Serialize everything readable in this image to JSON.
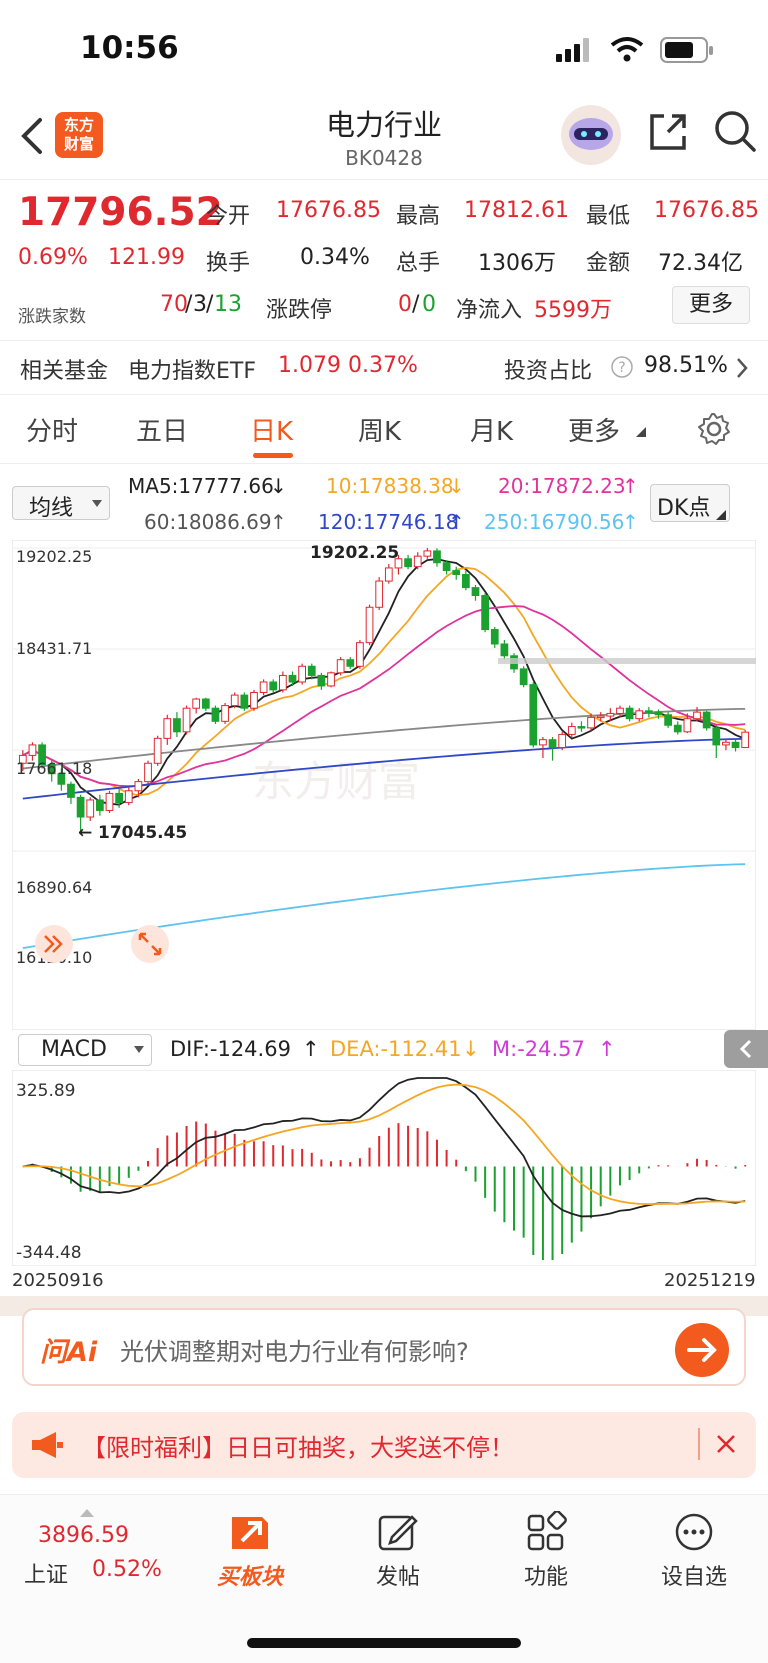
{
  "status_bar": {
    "time": "10:56"
  },
  "header": {
    "logo_text": "东方\n财富",
    "title": "电力行业",
    "code": "BK0428"
  },
  "quote": {
    "price": "17796.52",
    "change_pct": "0.69%",
    "change_abs": "121.99",
    "open_label": "今开",
    "open": "17676.85",
    "high_label": "最高",
    "high": "17812.61",
    "low_label": "最低",
    "low": "17676.85",
    "turnover_label": "换手",
    "turnover": "0.34%",
    "volume_label": "总手",
    "volume": "1306万",
    "amount_label": "金额",
    "amount": "72.34亿",
    "adv_dec_label": "涨跌家数",
    "adv": "70",
    "flat": "3",
    "dec": "13",
    "limit_label": "涨跌停",
    "limit_up": "0",
    "limit_down": "0",
    "net_inflow_label": "净流入",
    "net_inflow": "5599万",
    "more": "更多"
  },
  "fund": {
    "label": "相关基金",
    "name": "电力指数ETF",
    "price": "1.079",
    "pct": "0.37%",
    "ratio_label": "投资占比",
    "ratio": "98.51%"
  },
  "tabs": [
    "分时",
    "五日",
    "日K",
    "周K",
    "月K",
    "更多"
  ],
  "ma": {
    "selector": "均线",
    "ma5": "MA5:17777.66",
    "ma10": "10:17838.38",
    "ma20": "20:17872.23",
    "ma60": "60:18086.69",
    "ma120": "120:17746.18",
    "ma250": "250:16790.56",
    "dk": "DK点"
  },
  "colors": {
    "up": "#e0282f",
    "down": "#1aa12f",
    "ma5": "#222222",
    "ma10": "#f5a623",
    "ma20": "#e0339e",
    "ma60": "#888888",
    "ma120": "#3047c7",
    "ma250": "#5ec3f0",
    "accent": "#f25a1e"
  },
  "chart_axis": {
    "y_top": "19202.25",
    "y_2": "18431.71",
    "y_3": "17661.18",
    "y_4": "16890.64",
    "y_bottom": "16120.10",
    "high_note": "19202.25",
    "low_note": "17045.45",
    "watermark": "东方财富"
  },
  "chart_data": {
    "type": "candlestick",
    "x_start": "20250916",
    "x_end": "20251219",
    "ylim": [
      16120.1,
      19202.25
    ],
    "annotations": {
      "max": 19202.25,
      "min": 17045.45
    },
    "candles": [
      [
        17560,
        17620,
        17500,
        17660
      ],
      [
        17620,
        17700,
        17580,
        17720
      ],
      [
        17700,
        17550,
        17520,
        17720
      ],
      [
        17550,
        17480,
        17420,
        17580
      ],
      [
        17480,
        17400,
        17350,
        17520
      ],
      [
        17400,
        17300,
        17250,
        17420
      ],
      [
        17300,
        17150,
        17045,
        17320
      ],
      [
        17150,
        17280,
        17120,
        17300
      ],
      [
        17280,
        17200,
        17160,
        17320
      ],
      [
        17200,
        17330,
        17180,
        17350
      ],
      [
        17330,
        17260,
        17220,
        17360
      ],
      [
        17260,
        17350,
        17240,
        17380
      ],
      [
        17350,
        17420,
        17300,
        17440
      ],
      [
        17420,
        17560,
        17400,
        17580
      ],
      [
        17560,
        17750,
        17540,
        17770
      ],
      [
        17750,
        17900,
        17700,
        17930
      ],
      [
        17900,
        17800,
        17760,
        17950
      ],
      [
        17800,
        17980,
        17780,
        18000
      ],
      [
        17980,
        18050,
        17940,
        18060
      ],
      [
        18050,
        17980,
        17960,
        18060
      ],
      [
        17980,
        17880,
        17860,
        18000
      ],
      [
        17880,
        18000,
        17860,
        18020
      ],
      [
        18000,
        18080,
        17980,
        18100
      ],
      [
        18080,
        17980,
        17960,
        18100
      ],
      [
        17980,
        18100,
        17960,
        18120
      ],
      [
        18100,
        18180,
        18080,
        18200
      ],
      [
        18180,
        18120,
        18100,
        18200
      ],
      [
        18120,
        18230,
        18100,
        18260
      ],
      [
        18230,
        18180,
        18150,
        18260
      ],
      [
        18180,
        18300,
        18160,
        18320
      ],
      [
        18300,
        18230,
        18200,
        18320
      ],
      [
        18230,
        18150,
        18120,
        18250
      ],
      [
        18150,
        18250,
        18140,
        18260
      ],
      [
        18250,
        18350,
        18230,
        18370
      ],
      [
        18350,
        18300,
        18280,
        18370
      ],
      [
        18300,
        18480,
        18280,
        18500
      ],
      [
        18480,
        18750,
        18460,
        18770
      ],
      [
        18750,
        18950,
        18730,
        18980
      ],
      [
        18950,
        19050,
        18930,
        19080
      ],
      [
        19050,
        19120,
        19000,
        19150
      ],
      [
        19120,
        19060,
        19040,
        19150
      ],
      [
        19060,
        19140,
        19040,
        19170
      ],
      [
        19140,
        19180,
        19120,
        19202
      ],
      [
        19180,
        19090,
        19060,
        19200
      ],
      [
        19090,
        19030,
        19000,
        19110
      ],
      [
        19030,
        19000,
        18960,
        19060
      ],
      [
        19000,
        18900,
        18880,
        19030
      ],
      [
        18900,
        18840,
        18800,
        18920
      ],
      [
        18840,
        18580,
        18560,
        18860
      ],
      [
        18580,
        18470,
        18440,
        18600
      ],
      [
        18470,
        18380,
        18350,
        18500
      ],
      [
        18380,
        18280,
        18250,
        18400
      ],
      [
        18280,
        18160,
        18140,
        18300
      ],
      [
        18160,
        17700,
        17680,
        18180
      ],
      [
        17700,
        17740,
        17600,
        17760
      ],
      [
        17740,
        17680,
        17580,
        17760
      ],
      [
        17680,
        17780,
        17660,
        17800
      ],
      [
        17780,
        17840,
        17760,
        17870
      ],
      [
        17840,
        17830,
        17800,
        17880
      ],
      [
        17830,
        17910,
        17810,
        17940
      ],
      [
        17910,
        17920,
        17880,
        17950
      ],
      [
        17920,
        17940,
        17880,
        17980
      ],
      [
        17940,
        17980,
        17910,
        18000
      ],
      [
        17980,
        17900,
        17880,
        18000
      ],
      [
        17900,
        17960,
        17880,
        17980
      ],
      [
        17960,
        17950,
        17910,
        17990
      ],
      [
        17950,
        17930,
        17900,
        17970
      ],
      [
        17930,
        17850,
        17830,
        17950
      ],
      [
        17850,
        17800,
        17780,
        17880
      ],
      [
        17800,
        17900,
        17790,
        17940
      ],
      [
        17900,
        17950,
        17880,
        17990
      ],
      [
        17950,
        17830,
        17810,
        17960
      ],
      [
        17830,
        17700,
        17600,
        17850
      ],
      [
        17700,
        17720,
        17660,
        17740
      ],
      [
        17720,
        17680,
        17650,
        17740
      ],
      [
        17680,
        17797,
        17676,
        17813
      ]
    ],
    "macd": {
      "ylim": [
        -344.48,
        325.89
      ],
      "dif": -124.69,
      "dea": -112.41,
      "m": -24.57
    }
  },
  "macd_header": {
    "selector": "MACD",
    "dif": "DIF:-124.69",
    "dea": "DEA:-112.41",
    "m": "M:-24.57",
    "y_top": "325.89",
    "y_bottom": "-344.48"
  },
  "dates": {
    "start": "20250916",
    "end": "20251219"
  },
  "ai": {
    "badge": "问Ai",
    "question": "光伏调整期对电力行业有何影响?"
  },
  "promo": {
    "text": "【限时福利】日日可抽奖，大奖送不停！"
  },
  "bottom_nav": {
    "index_value": "3896.59",
    "index_name": "上证",
    "index_pct": "0.52%",
    "buy_block": "买板块",
    "post": "发帖",
    "func": "功能",
    "watch": "设自选"
  }
}
